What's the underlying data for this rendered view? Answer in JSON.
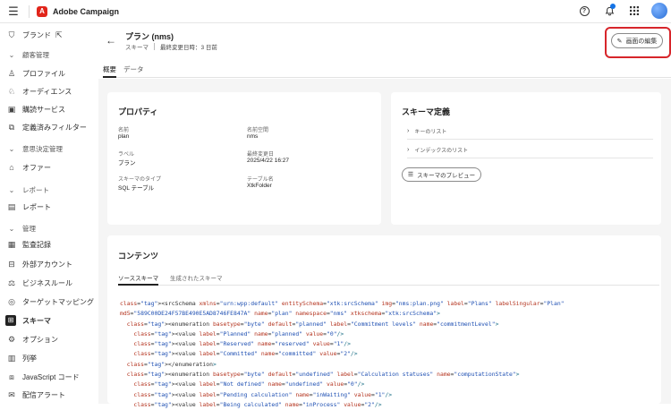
{
  "app": {
    "title": "Adobe Campaign",
    "logo_glyph": "A",
    "brand_color": "#e1251b"
  },
  "topbar": {
    "menu_glyph": "☰",
    "help_glyph": "?",
    "bell_glyph": "🔔",
    "grid_glyph": "⋮⋮⋮"
  },
  "sidebar": {
    "items": [
      {
        "label": "ブランド",
        "icon": "brand-icon",
        "glyph": "⛉"
      },
      {
        "section": "顧客管理"
      },
      {
        "label": "プロファイル",
        "icon": "profile-icon",
        "glyph": "♙"
      },
      {
        "label": "オーディエンス",
        "icon": "audience-icon",
        "glyph": "♘"
      },
      {
        "label": "購読サービス",
        "icon": "subscription-icon",
        "glyph": "▣"
      },
      {
        "label": "定義済みフィルター",
        "icon": "filter-icon",
        "glyph": "⧉"
      },
      {
        "section": "意思決定管理"
      },
      {
        "label": "オファー",
        "icon": "offer-icon",
        "glyph": "⌂"
      },
      {
        "section": "レポート"
      },
      {
        "label": "レポート",
        "icon": "report-icon",
        "glyph": "▤"
      },
      {
        "section": "管理"
      },
      {
        "label": "監査記録",
        "icon": "audit-icon",
        "glyph": "▦"
      },
      {
        "label": "外部アカウント",
        "icon": "external-account-icon",
        "glyph": "⊟"
      },
      {
        "label": "ビジネスルール",
        "icon": "business-rule-icon",
        "glyph": "⚖"
      },
      {
        "label": "ターゲットマッピング",
        "icon": "target-mapping-icon",
        "glyph": "◎"
      },
      {
        "label": "スキーマ",
        "icon": "schema-icon",
        "glyph": "⊞",
        "active": true
      },
      {
        "label": "オプション",
        "icon": "options-icon",
        "glyph": "⚙"
      },
      {
        "label": "列挙",
        "icon": "enumeration-icon",
        "glyph": "▥"
      },
      {
        "label": "JavaScript コード",
        "icon": "javascript-icon",
        "glyph": "⧈"
      },
      {
        "label": "配信アラート",
        "icon": "alert-icon",
        "glyph": "✉"
      }
    ]
  },
  "header": {
    "back_glyph": "←",
    "title": "プラン (nms)",
    "type": "スキーマ",
    "last_modified": "最終変更日時：3 日前"
  },
  "edit_button": {
    "label": "画面の編集",
    "glyph": "✎"
  },
  "tabs": [
    {
      "label": "概要"
    },
    {
      "label": "データ"
    }
  ],
  "properties": {
    "title": "プロパティ",
    "fields": [
      {
        "label": "名前",
        "value": "plan"
      },
      {
        "label": "名前空間",
        "value": "nms"
      },
      {
        "label": "ラベル",
        "value": "プラン"
      },
      {
        "label": "最終変更日",
        "value": "2025/4/22 16:27"
      },
      {
        "label": "スキーマのタイプ",
        "value": "SQL テーブル"
      },
      {
        "label": "テーブル名",
        "value": "XtkFolder"
      }
    ]
  },
  "schema_definition": {
    "title": "スキーマ定義",
    "rows": [
      {
        "label": "キーのリスト"
      },
      {
        "label": "インデックスのリスト"
      }
    ],
    "preview_label": "スキーマのプレビュー",
    "preview_glyph": "☰"
  },
  "content": {
    "title": "コンテンツ",
    "subtabs": [
      {
        "label": "ソーススキーマ"
      },
      {
        "label": "生成されたスキーマ"
      }
    ],
    "code_lines": [
      "<srcSchema xmlns=\"urn:wpp:default\" entitySchema=\"xtk:srcSchema\" img=\"nms:plan.png\" label=\"Plans\" labelSingular=\"Plan\"",
      "md5=\"589C00DE24F57BE490E5AD8746FE847A\" name=\"plan\" namespace=\"nms\" xtkschema=\"xtk:srcSchema\">",
      "  <enumeration basetype=\"byte\" default=\"planned\" label=\"Commitment levels\" name=\"commitmentLevel\">",
      "    <value label=\"Planned\" name=\"planned\" value=\"0\"/>",
      "    <value label=\"Reserved\" name=\"reserved\" value=\"1\"/>",
      "    <value label=\"Committed\" name=\"committed\" value=\"2\"/>",
      "  </enumeration>",
      "  <enumeration basetype=\"byte\" default=\"undefined\" label=\"Calculation statuses\" name=\"computationState\">",
      "    <value label=\"Not defined\" name=\"undefined\" value=\"0\"/>",
      "    <value label=\"Pending calculation\" name=\"inWaiting\" value=\"1\"/>",
      "    <value label=\"Being calculated\" name=\"inProcess\" value=\"2\"/>"
    ]
  }
}
